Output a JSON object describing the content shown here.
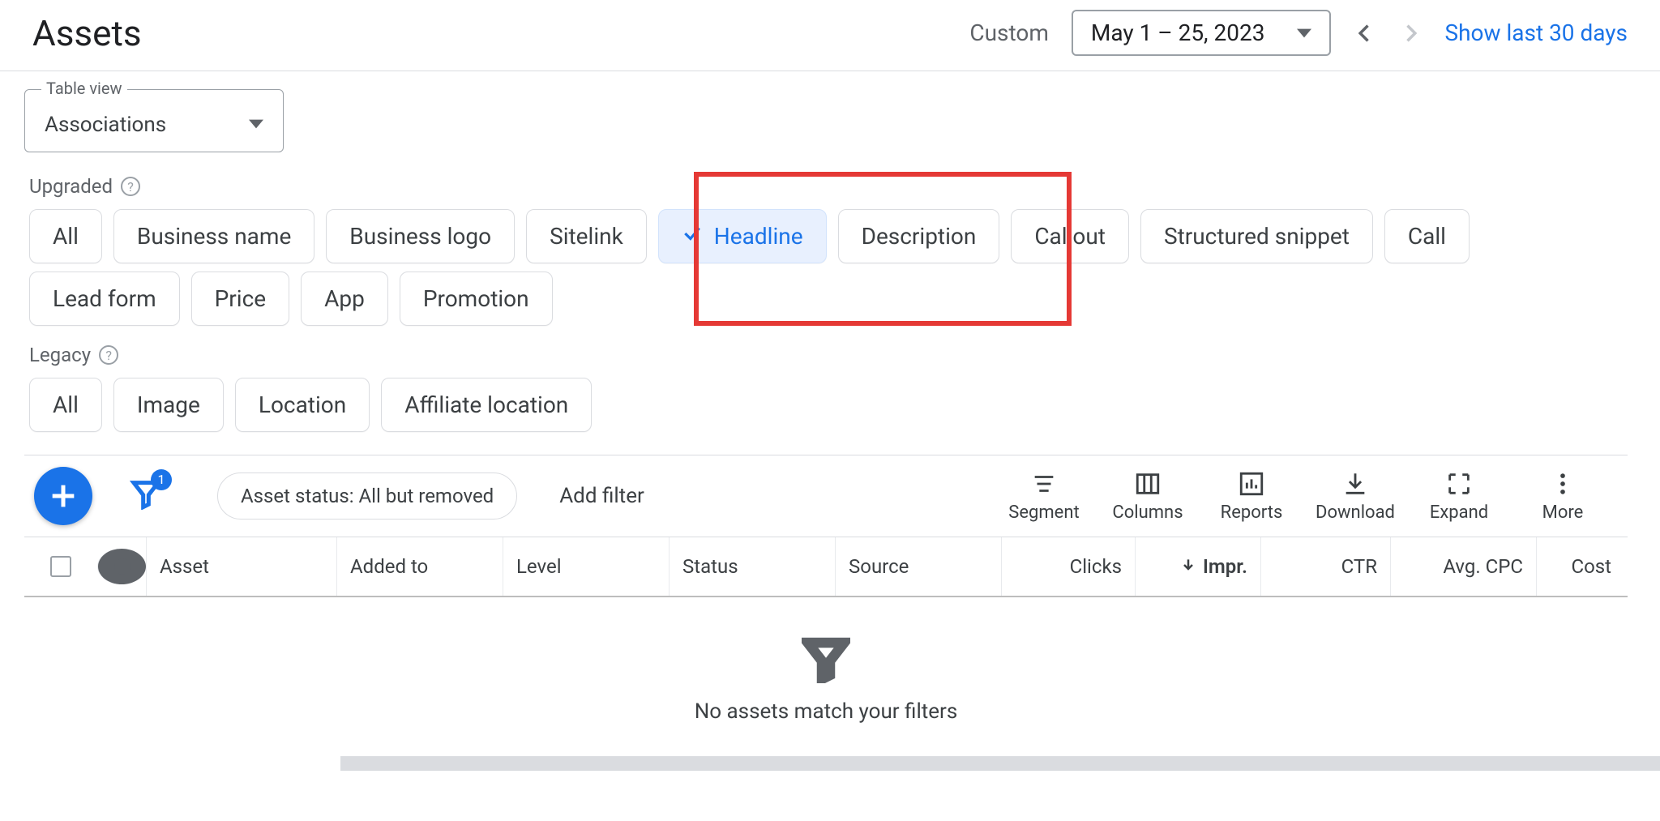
{
  "header": {
    "title": "Assets",
    "date_mode_label": "Custom",
    "date_range": "May 1 – 25, 2023",
    "show_last_30": "Show last 30 days"
  },
  "table_view": {
    "legend": "Table view",
    "value": "Associations"
  },
  "sections": {
    "upgraded_label": "Upgraded",
    "legacy_label": "Legacy"
  },
  "upgraded_chips": [
    {
      "label": "All",
      "selected": false
    },
    {
      "label": "Business name",
      "selected": false
    },
    {
      "label": "Business logo",
      "selected": false
    },
    {
      "label": "Sitelink",
      "selected": false
    },
    {
      "label": "Headline",
      "selected": true
    },
    {
      "label": "Description",
      "selected": false
    },
    {
      "label": "Callout",
      "selected": false
    },
    {
      "label": "Structured snippet",
      "selected": false
    },
    {
      "label": "Call",
      "selected": false
    },
    {
      "label": "Lead form",
      "selected": false
    },
    {
      "label": "Price",
      "selected": false
    },
    {
      "label": "App",
      "selected": false
    },
    {
      "label": "Promotion",
      "selected": false
    }
  ],
  "legacy_chips": [
    {
      "label": "All"
    },
    {
      "label": "Image"
    },
    {
      "label": "Location"
    },
    {
      "label": "Affiliate location"
    }
  ],
  "toolbar": {
    "filter_count": "1",
    "status_filter": "Asset status: All but removed",
    "add_filter": "Add filter",
    "segment": "Segment",
    "columns": "Columns",
    "reports": "Reports",
    "download": "Download",
    "expand": "Expand",
    "more": "More"
  },
  "columns": {
    "asset": "Asset",
    "added": "Added to",
    "level": "Level",
    "status": "Status",
    "source": "Source",
    "clicks": "Clicks",
    "impr": "Impr.",
    "ctr": "CTR",
    "cpc": "Avg. CPC",
    "cost": "Cost"
  },
  "empty_message": "No assets match your filters"
}
